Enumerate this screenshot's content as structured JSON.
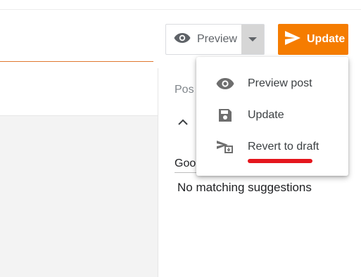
{
  "toolbar": {
    "preview_label": "Preview",
    "update_label": "Update",
    "accent_color": "#f57c00"
  },
  "sidebar": {
    "header": "Pos",
    "input_value": "Goo",
    "suggestion": "No matching suggestions"
  },
  "dropdown_menu": {
    "items": [
      {
        "label": "Preview post",
        "icon": "eye-icon"
      },
      {
        "label": "Update",
        "icon": "save-icon"
      },
      {
        "label": "Revert to draft",
        "icon": "revert-draft-icon"
      }
    ],
    "annotation_color": "#e5161d"
  }
}
